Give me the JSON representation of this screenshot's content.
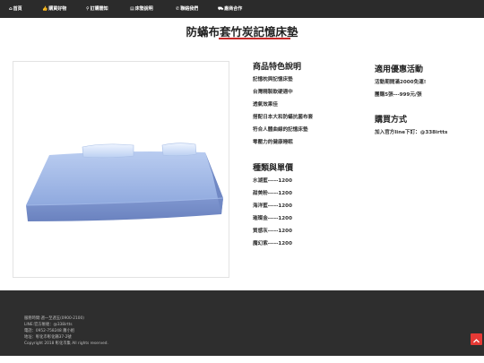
{
  "nav": {
    "items": [
      {
        "icon": "home-icon",
        "glyph": "⌂",
        "label": "首頁"
      },
      {
        "icon": "thumbs-up-icon",
        "glyph": "👍",
        "label": "購買好物"
      },
      {
        "icon": "search-list-icon",
        "glyph": "⚲",
        "label": "訂購需知"
      },
      {
        "icon": "book-icon",
        "glyph": "▤",
        "label": "床墊說明"
      },
      {
        "icon": "phone-icon",
        "glyph": "✆",
        "label": "聯絡我們"
      },
      {
        "icon": "cart-icon",
        "glyph": "⛟",
        "label": "廠商合作"
      }
    ]
  },
  "page": {
    "title": "防蟎布套竹炭記憶床墊"
  },
  "features": {
    "heading": "商品特色說明",
    "items": [
      "記憶枕與記憶床墊",
      "台灣精製軟硬適中",
      "透氣效果佳",
      "搭配日本大和防蟎抗菌布套",
      "符合人體曲線的記憶床墊",
      "零壓力的健康睡眠"
    ]
  },
  "variants": {
    "heading": "種類與單價",
    "items": [
      "水湖藍-----1200",
      "甜美粉-----1200",
      "海洋藍-----1200",
      "璀璨金-----1200",
      "質感灰-----1200",
      "魔幻紫-----1200"
    ]
  },
  "promo": {
    "heading": "適用優惠活動",
    "line1": "活動期間滿2000免運!",
    "line2": "團購5張---999元/張"
  },
  "purchase": {
    "heading": "購買方式",
    "line1": "加入官方line下訂：@338irtts"
  },
  "footer": {
    "lines": [
      "服務時間:週一至週五(0900-2100)",
      "LINE:官方帳號：@338irtts",
      "電話：0952-758248 蕭小姐",
      "地址：彰化市彰化縣37-2號",
      "Copyright 2018 彰化市集 All rights reserved."
    ]
  },
  "colors": {
    "navbar": "#2b2b2b",
    "accent": "#c62828",
    "footer": "#2e2e2e",
    "mattress": "#8aa5dc"
  }
}
